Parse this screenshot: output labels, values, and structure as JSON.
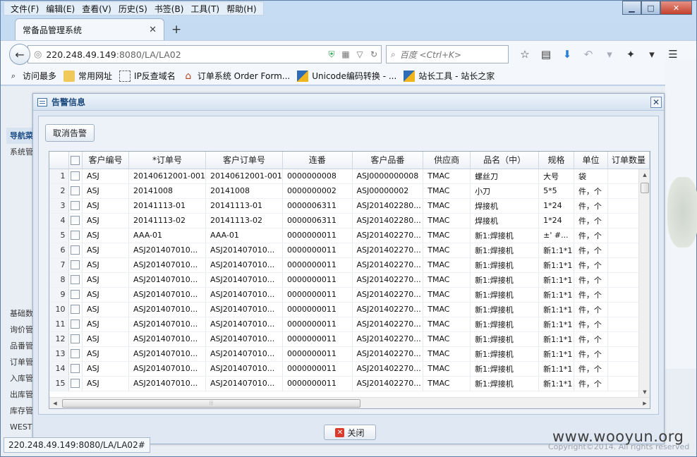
{
  "browser": {
    "menu": [
      "文件(F)",
      "编辑(E)",
      "查看(V)",
      "历史(S)",
      "书签(B)",
      "工具(T)",
      "帮助(H)"
    ],
    "tab_title": "常备品管理系统",
    "url_host": "220.248.49.149",
    "url_rest": ":8080/LA/LA02",
    "search_placeholder": "百度 <Ctrl+K>",
    "bookmarks": [
      "访问最多",
      "常用网址",
      "IP反查域名",
      "订单系统 Order Form...",
      "Unicode编码转换 - ...",
      "站长工具 - 站长之家"
    ],
    "status_url": "220.248.49.149:8080/LA/LA02#"
  },
  "page": {
    "left_nav": [
      "导航菜",
      "系统管",
      "基础数",
      "询价管",
      "品番管",
      "订单管",
      "入库管",
      "出库管",
      "库存管",
      "WEST"
    ],
    "copyright": "Copyright©2014. All rights reserved",
    "watermark": "www.wooyun.org"
  },
  "modal": {
    "title": "告警信息",
    "cancel_alarm_label": "取消告警",
    "close_label": "关闭",
    "columns": [
      "",
      "客户编号",
      "*订单号",
      "客户订单号",
      "连番",
      "客户品番",
      "供应商",
      "品名（中）",
      "规格",
      "单位",
      "订单数量"
    ],
    "rows": [
      [
        "1",
        "ASJ",
        "20140612001-001",
        "20140612001-001",
        "0000000008",
        "ASJ0000000008",
        "TMAC",
        "螺丝刀",
        "大号",
        "袋"
      ],
      [
        "2",
        "ASJ",
        "20141008",
        "20141008",
        "0000000002",
        "ASJ00000002",
        "TMAC",
        "小刀",
        "5*5",
        "件，个"
      ],
      [
        "3",
        "ASJ",
        "20141113-01",
        "20141113-01",
        "0000006311",
        "ASJ201402280...",
        "TMAC",
        "焊接机",
        "1*24",
        "件，个"
      ],
      [
        "4",
        "ASJ",
        "20141113-02",
        "20141113-02",
        "0000006311",
        "ASJ201402280...",
        "TMAC",
        "焊接机",
        "1*24",
        "件，个"
      ],
      [
        "5",
        "ASJ",
        "AAA-01",
        "AAA-01",
        "0000000011",
        "ASJ201402270...",
        "TMAC",
        "新1:焊接机",
        "±' #...",
        "件，个"
      ],
      [
        "6",
        "ASJ",
        "ASJ201407010...",
        "ASJ201407010...",
        "0000000011",
        "ASJ201402270...",
        "TMAC",
        "新1:焊接机",
        "新1:1*1",
        "件，个"
      ],
      [
        "7",
        "ASJ",
        "ASJ201407010...",
        "ASJ201407010...",
        "0000000011",
        "ASJ201402270...",
        "TMAC",
        "新1:焊接机",
        "新1:1*1",
        "件，个"
      ],
      [
        "8",
        "ASJ",
        "ASJ201407010...",
        "ASJ201407010...",
        "0000000011",
        "ASJ201402270...",
        "TMAC",
        "新1:焊接机",
        "新1:1*1",
        "件，个"
      ],
      [
        "9",
        "ASJ",
        "ASJ201407010...",
        "ASJ201407010...",
        "0000000011",
        "ASJ201402270...",
        "TMAC",
        "新1:焊接机",
        "新1:1*1",
        "件，个"
      ],
      [
        "10",
        "ASJ",
        "ASJ201407010...",
        "ASJ201407010...",
        "0000000011",
        "ASJ201402270...",
        "TMAC",
        "新1:焊接机",
        "新1:1*1",
        "件，个"
      ],
      [
        "11",
        "ASJ",
        "ASJ201407010...",
        "ASJ201407010...",
        "0000000011",
        "ASJ201402270...",
        "TMAC",
        "新1:焊接机",
        "新1:1*1",
        "件，个"
      ],
      [
        "12",
        "ASJ",
        "ASJ201407010...",
        "ASJ201407010...",
        "0000000011",
        "ASJ201402270...",
        "TMAC",
        "新1:焊接机",
        "新1:1*1",
        "件，个"
      ],
      [
        "13",
        "ASJ",
        "ASJ201407010...",
        "ASJ201407010...",
        "0000000011",
        "ASJ201402270...",
        "TMAC",
        "新1:焊接机",
        "新1:1*1",
        "件，个"
      ],
      [
        "14",
        "ASJ",
        "ASJ201407010...",
        "ASJ201407010...",
        "0000000011",
        "ASJ201402270...",
        "TMAC",
        "新1:焊接机",
        "新1:1*1",
        "件，个"
      ],
      [
        "15",
        "ASJ",
        "ASJ201407010...",
        "ASJ201407010...",
        "0000000011",
        "ASJ201402270...",
        "TMAC",
        "新1:焊接机",
        "新1:1*1",
        "件，个"
      ]
    ]
  }
}
